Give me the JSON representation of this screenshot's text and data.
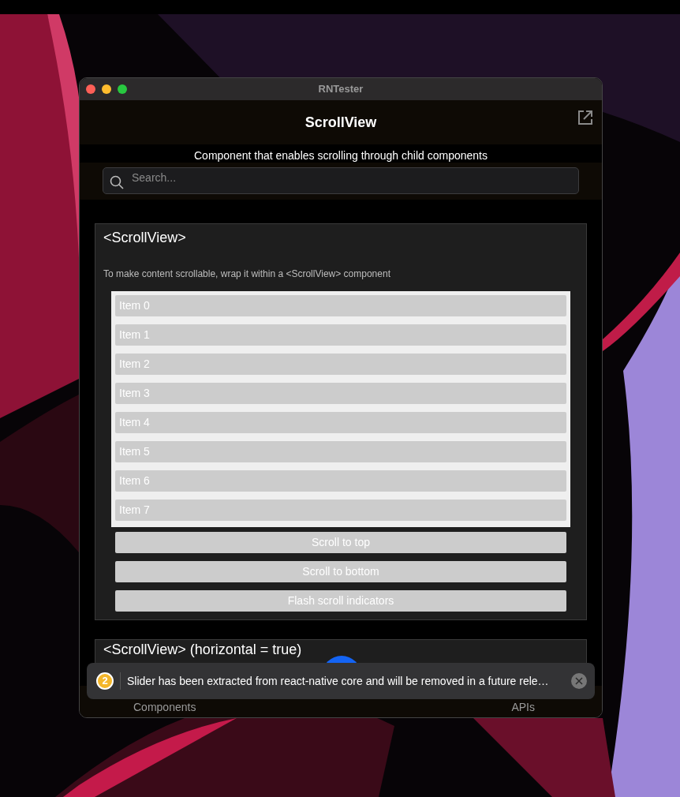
{
  "window": {
    "title": "RNTester"
  },
  "header": {
    "title": "ScrollView"
  },
  "description": "Component that enables scrolling through child components",
  "search": {
    "placeholder": "Search..."
  },
  "examples": [
    {
      "title": "<ScrollView>",
      "description": "To make content scrollable, wrap it within a <ScrollView> component",
      "items": [
        "Item 0",
        "Item 1",
        "Item 2",
        "Item 3",
        "Item 4",
        "Item 5",
        "Item 6",
        "Item 7"
      ],
      "buttons": [
        "Scroll to top",
        "Scroll to bottom",
        "Flash scroll indicators"
      ]
    },
    {
      "title": "<ScrollView> (horizontal = true)"
    }
  ],
  "tabs": [
    {
      "label": "Components"
    },
    {
      "label": "APIs"
    }
  ],
  "toast": {
    "count": "2",
    "message": "Slider has been extracted from react-native core and will be removed in a future rele…"
  }
}
